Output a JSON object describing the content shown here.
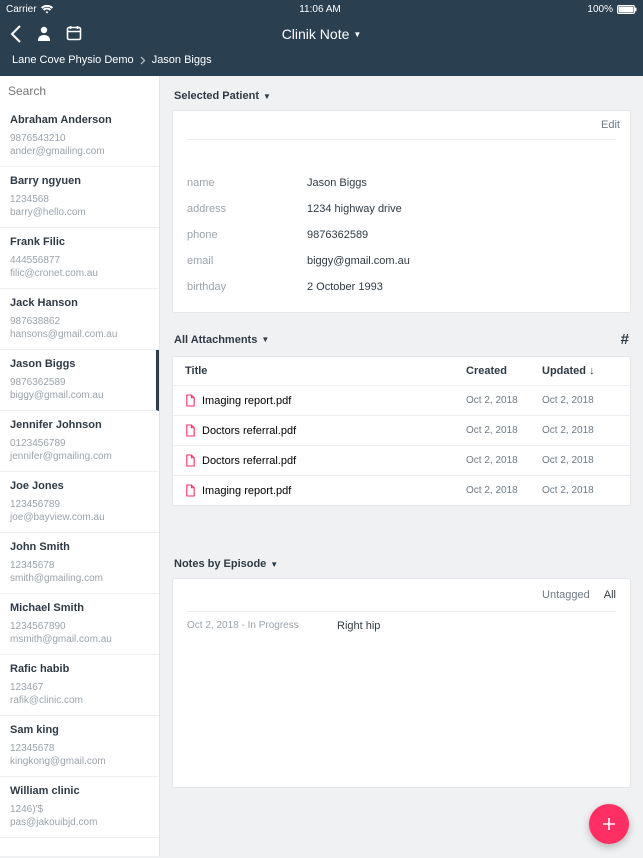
{
  "status": {
    "carrier": "Carrier",
    "wifi": "􀙇",
    "time": "11:06 AM",
    "battery_pct": "100%"
  },
  "header": {
    "title": "Clinik Note"
  },
  "breadcrumb": {
    "root": "Lane Cove Physio Demo",
    "current": "Jason Biggs"
  },
  "search": {
    "placeholder": "Search"
  },
  "patients": [
    {
      "name": "Abraham Anderson",
      "phone": "9876543210",
      "email": "ander@gmailing.com"
    },
    {
      "name": "Barry ngyuen",
      "phone": "1234568",
      "email": "barry@hello.com"
    },
    {
      "name": "Frank Filic",
      "phone": "444556877",
      "email": "filic@cronet.com.au"
    },
    {
      "name": "Jack Hanson",
      "phone": "987638862",
      "email": "hansons@gmail.com.au"
    },
    {
      "name": "Jason Biggs",
      "phone": "9876362589",
      "email": "biggy@gmail.com.au",
      "selected": true
    },
    {
      "name": "Jennifer Johnson",
      "phone": "0123456789",
      "email": "jennifer@gmailing.com"
    },
    {
      "name": "Joe Jones",
      "phone": "123456789",
      "email": "joe@bayview.com.au"
    },
    {
      "name": "John Smith",
      "phone": "12345678",
      "email": "smith@gmailing.com"
    },
    {
      "name": "Michael Smith",
      "phone": "1234567890",
      "email": "msmith@gmail.com.au"
    },
    {
      "name": "Rafic habib",
      "phone": "123467",
      "email": "rafik@clinic.com"
    },
    {
      "name": "Sam king",
      "phone": "12345678",
      "email": "kingkong@gmail.com"
    },
    {
      "name": "William  clinic",
      "phone": "1246)'$",
      "email": "pas@jakouibjd.com"
    }
  ],
  "selected_patient": {
    "header": "Selected Patient",
    "edit": "Edit",
    "labels": {
      "name": "name",
      "address": "address",
      "phone": "phone",
      "email": "email",
      "birthday": "birthday"
    },
    "values": {
      "name": "Jason Biggs",
      "address": "1234 highway drive",
      "phone": "9876362589",
      "email": "biggy@gmail.com.au",
      "birthday": "2 October 1993"
    }
  },
  "attachments": {
    "header": "All Attachments",
    "columns": {
      "title": "Title",
      "created": "Created",
      "updated": "Updated"
    },
    "rows": [
      {
        "title": "Imaging report.pdf",
        "created": "Oct 2, 2018",
        "updated": "Oct 2, 2018"
      },
      {
        "title": "Doctors referral.pdf",
        "created": "Oct 2, 2018",
        "updated": "Oct 2, 2018"
      },
      {
        "title": "Doctors referral.pdf",
        "created": "Oct 2, 2018",
        "updated": "Oct 2, 2018"
      },
      {
        "title": "Imaging report.pdf",
        "created": "Oct 2, 2018",
        "updated": "Oct 2, 2018"
      }
    ]
  },
  "notes": {
    "header": "Notes by Episode",
    "tabs": {
      "untagged": "Untagged",
      "all": "All"
    },
    "rows": [
      {
        "meta": "Oct 2, 2018 - In Progress",
        "title": "Right hip"
      }
    ]
  }
}
